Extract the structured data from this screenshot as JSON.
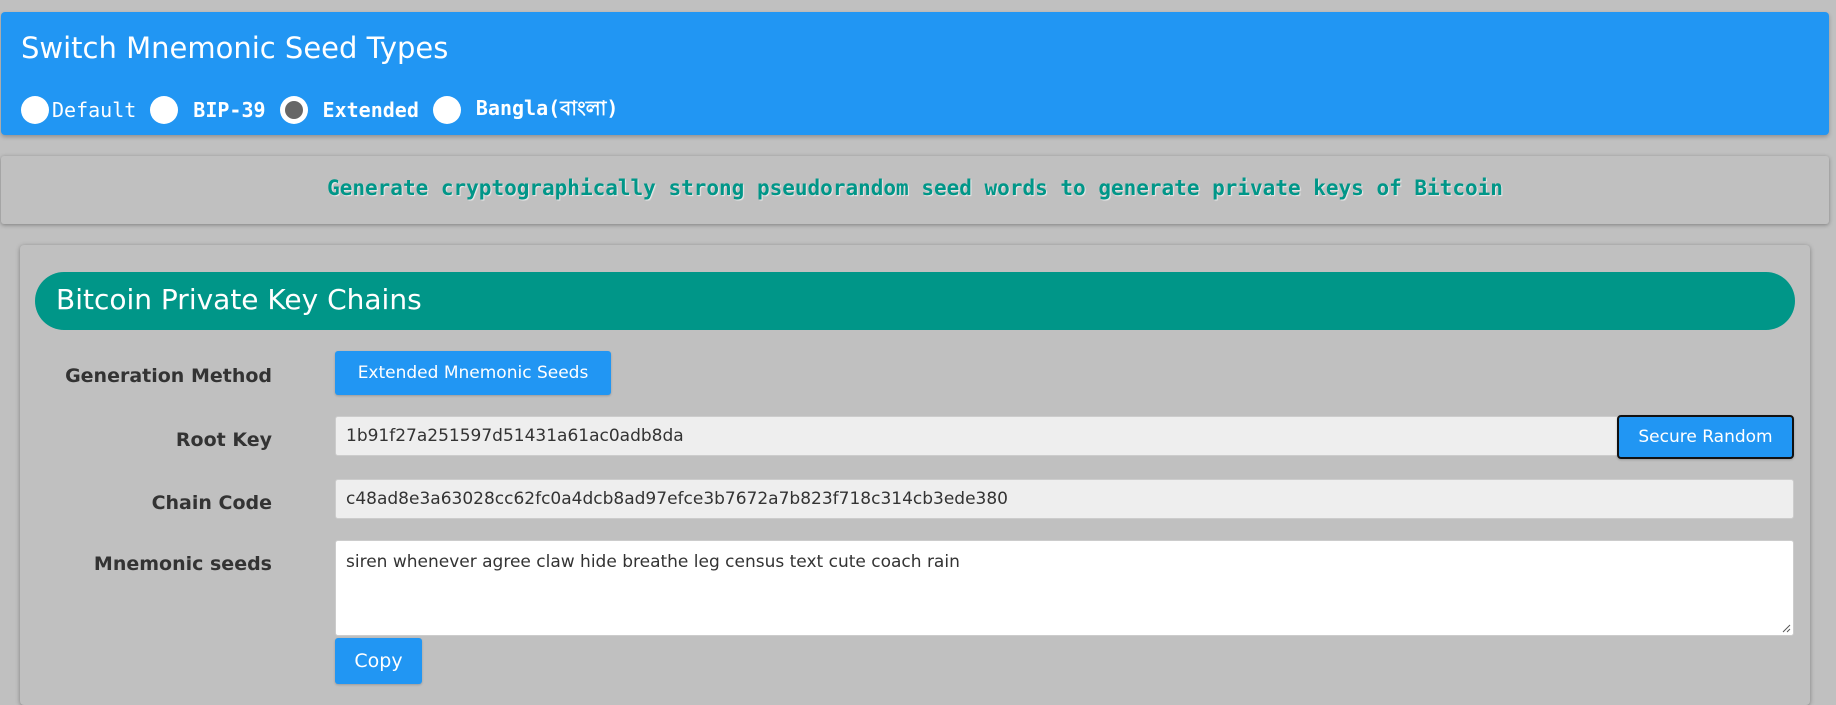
{
  "seed_switch": {
    "title": "Switch Mnemonic Seed Types",
    "options": [
      {
        "label": "Default",
        "checked": false
      },
      {
        "label": "BIP-39",
        "checked": false
      },
      {
        "label": "Extended",
        "checked": true
      },
      {
        "label": "Bangla(বাংলা)",
        "checked": false
      }
    ]
  },
  "tagline": "Generate cryptographically strong pseudorandom seed words to generate private keys of Bitcoin",
  "panel": {
    "title": "Bitcoin Private Key Chains",
    "generation_method": {
      "label": "Generation Method",
      "button": "Extended Mnemonic Seeds"
    },
    "root_key": {
      "label": "Root Key",
      "value": "1b91f27a251597d51431a61ac0adb8da",
      "button": "Secure Random"
    },
    "chain_code": {
      "label": "Chain Code",
      "value": "c48ad8e3a63028cc62fc0a4dcb8ad97efce3b7672a7b823f718c314cb3ede380"
    },
    "mnemonic_seeds": {
      "label": "Mnemonic seeds",
      "value": "siren whenever agree claw hide breathe leg census text cute coach rain",
      "copy_button": "Copy"
    }
  },
  "colors": {
    "page_background": "#c0c0c0",
    "primary_blue": "#2196f3",
    "teal": "#009688"
  }
}
